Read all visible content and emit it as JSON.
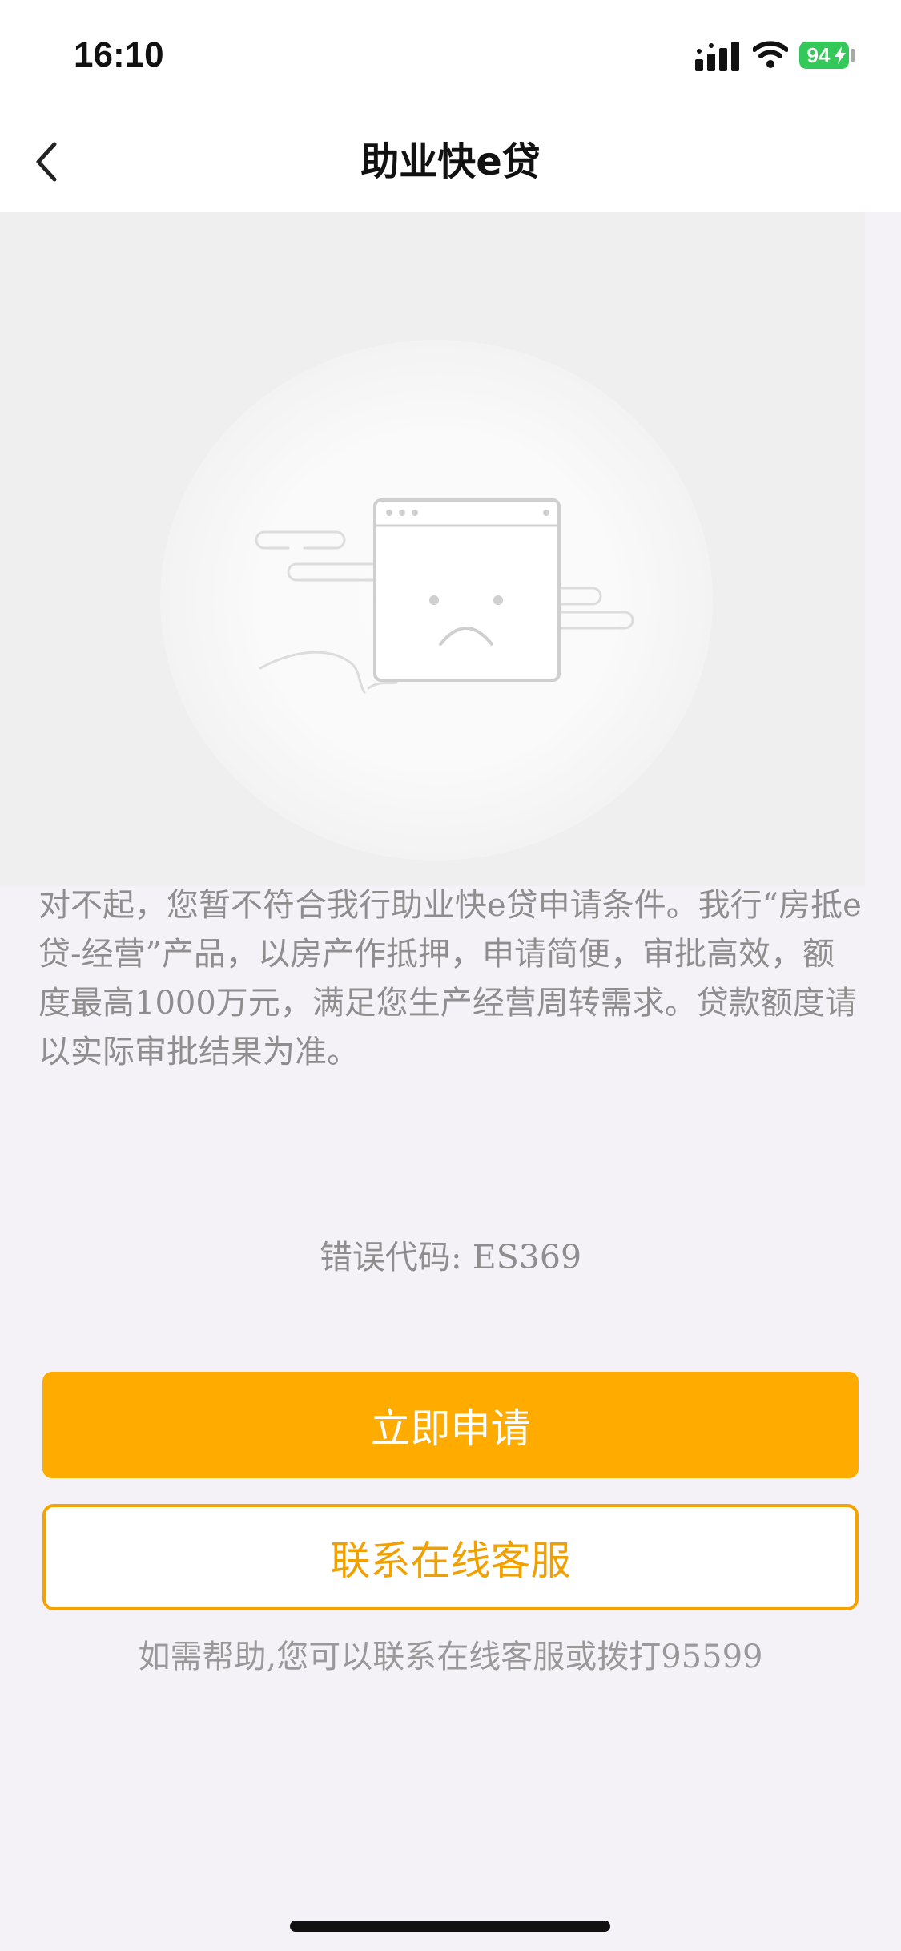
{
  "status_bar": {
    "time": "16:10",
    "battery_level": "94"
  },
  "nav": {
    "title": "助业快e贷",
    "back_icon": "chevron-left-icon"
  },
  "illustration": {
    "icon": "sad-browser-window-icon"
  },
  "content": {
    "message": "对不起，您暂不符合我行助业快e贷申请条件。我行“房抵e贷-经营”产品，以房产作抵押，申请简便，审批高效，额度最高1000万元，满足您生产经营周转需求。贷款额度请以实际审批结果为准。",
    "error_code": "错误代码: ES369"
  },
  "actions": {
    "apply_label": "立即申请",
    "service_label": "联系在线客服",
    "help_text": "如需帮助,您可以联系在线客服或拨打95599"
  },
  "colors": {
    "accent": "#ffab00",
    "outline": "#f5a300",
    "battery": "#34c759",
    "background": "#f5f2f7"
  }
}
